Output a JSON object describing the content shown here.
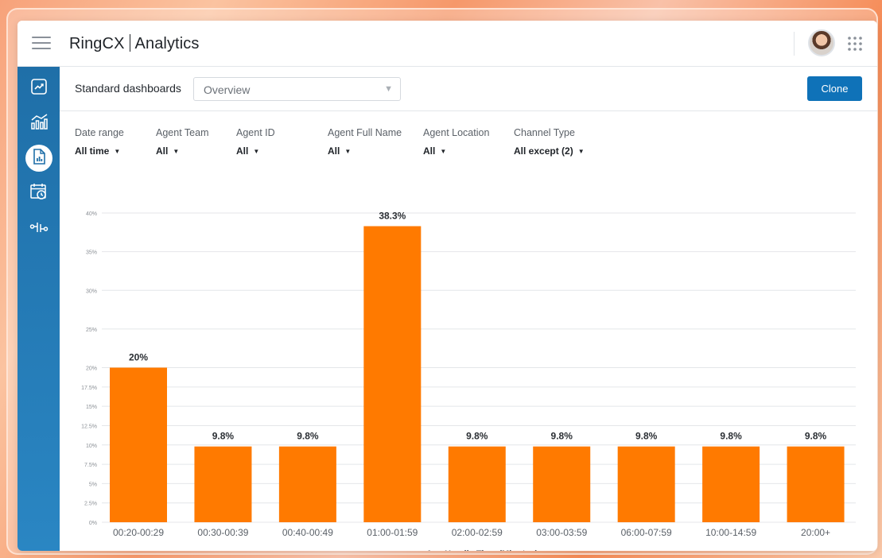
{
  "app": {
    "brand_name": "RingCX",
    "brand_section": "Analytics"
  },
  "sidebar": {
    "items": [
      {
        "icon": "trend-chart-icon",
        "active": false
      },
      {
        "icon": "bar-chart-icon",
        "active": false
      },
      {
        "icon": "report-document-icon",
        "active": true
      },
      {
        "icon": "calendar-clock-icon",
        "active": false
      },
      {
        "icon": "flow-network-icon",
        "active": false
      }
    ]
  },
  "dashboard": {
    "label": "Standard dashboards",
    "selected": "Overview",
    "clone_label": "Clone"
  },
  "filters": [
    {
      "label": "Date range",
      "value": "All time"
    },
    {
      "label": "Agent Team",
      "value": "All"
    },
    {
      "label": "Agent ID",
      "value": "All"
    },
    {
      "label": "Agent Full Name",
      "value": "All"
    },
    {
      "label": "Agent Location",
      "value": "All"
    },
    {
      "label": "Channel Type",
      "value": "All except (2)"
    }
  ],
  "colors": {
    "accent": "#0f72b8",
    "sidebar": "#1f6fa8",
    "bar": "#ff7a00"
  },
  "chart_data": {
    "type": "bar",
    "categories": [
      "00:20-00:29",
      "00:30-00:39",
      "00:40-00:49",
      "01:00-01:59",
      "02:00-02:59",
      "03:00-03:59",
      "06:00-07:59",
      "10:00-14:59",
      "20:00+"
    ],
    "values": [
      20,
      9.8,
      9.8,
      38.3,
      9.8,
      9.8,
      9.8,
      9.8,
      9.8
    ],
    "data_labels": [
      "20%",
      "9.8%",
      "9.8%",
      "38.3%",
      "9.8%",
      "9.8%",
      "9.8%",
      "9.8%",
      "9.8%"
    ],
    "xlabel": "Avg Handle Time (Minutes)",
    "ylabel": "",
    "ylim": [
      0,
      40
    ],
    "yticks": [
      0,
      2.5,
      5,
      7.5,
      10,
      12.5,
      15,
      17.5,
      20,
      25,
      30,
      35,
      40
    ],
    "ytick_labels": [
      "0%",
      "2.5%",
      "5%",
      "7.5%",
      "10%",
      "12.5%",
      "15%",
      "17.5%",
      "20%",
      "25%",
      "30%",
      "35%",
      "40%"
    ],
    "grid": true,
    "legend": "none"
  }
}
